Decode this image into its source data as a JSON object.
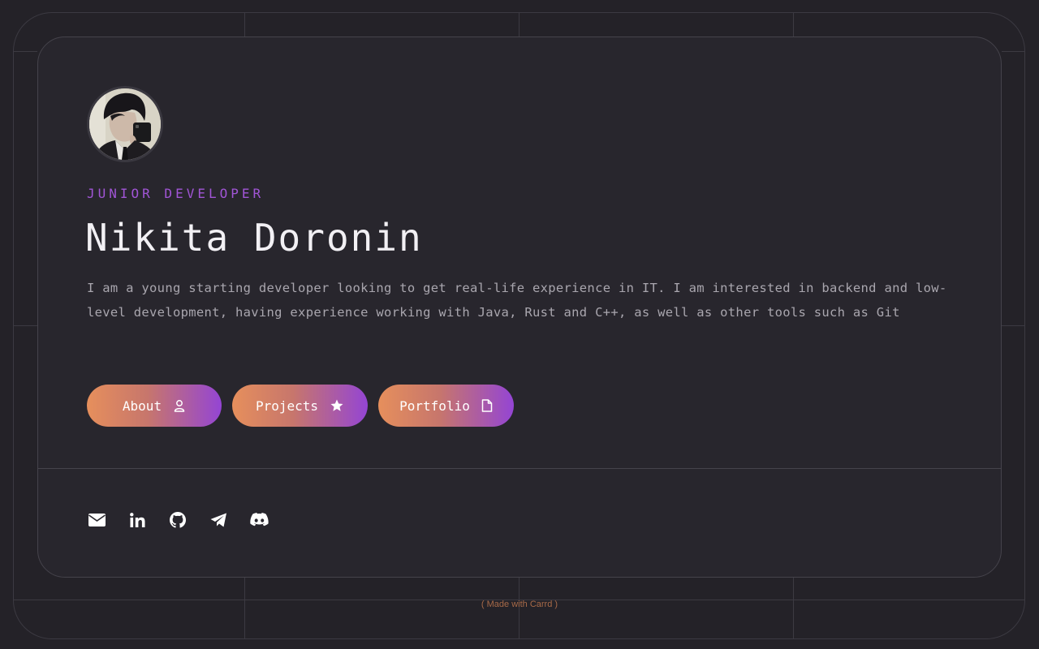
{
  "profile": {
    "role": "JUNIOR DEVELOPER",
    "name": "Nikita Doronin",
    "bio": "I am a young starting developer looking to get real-life experience in IT. I am interested in backend and low-level development, having experience working with Java, Rust and C++, as well as other tools such as Git",
    "avatar_icon": "profile-photo"
  },
  "buttons": [
    {
      "label": "About",
      "icon": "user-icon"
    },
    {
      "label": "Projects",
      "icon": "star-icon"
    },
    {
      "label": "Portfolio",
      "icon": "document-icon"
    }
  ],
  "socials": [
    {
      "icon": "email-icon"
    },
    {
      "icon": "linkedin-icon"
    },
    {
      "icon": "github-icon"
    },
    {
      "icon": "telegram-icon"
    },
    {
      "icon": "discord-icon"
    }
  ],
  "footer": {
    "credit": "( Made with Carrd )"
  },
  "colors": {
    "background": "#242228",
    "card": "#28262d",
    "accent_purple": "#a155d6",
    "gradient_start": "#e68f5c",
    "gradient_end": "#9445d4",
    "credit": "#a86a48"
  }
}
